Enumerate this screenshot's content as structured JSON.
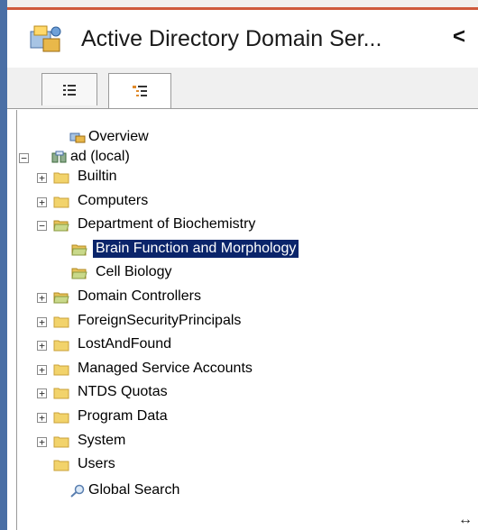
{
  "header": {
    "title": "Active Directory Domain Ser...",
    "collapse_symbol": "<",
    "icon": "ad-snapin-icon"
  },
  "tabs": [
    {
      "name": "list-view-tab",
      "icon": "list-icon",
      "active": false
    },
    {
      "name": "tree-view-tab",
      "icon": "tree-icon",
      "active": true
    }
  ],
  "tree": {
    "overview": "Overview",
    "root": "ad (local)",
    "items": [
      {
        "label": "Builtin",
        "expander": "+"
      },
      {
        "label": "Computers",
        "expander": "+"
      },
      {
        "label": "Department of Biochemistry",
        "expander": "−"
      },
      {
        "label": "Brain Function and Morphology",
        "selected": true
      },
      {
        "label": "Cell Biology"
      },
      {
        "label": "Domain Controllers",
        "expander": "+"
      },
      {
        "label": "ForeignSecurityPrincipals",
        "expander": "+"
      },
      {
        "label": "LostAndFound",
        "expander": "+"
      },
      {
        "label": "Managed Service Accounts",
        "expander": "+"
      },
      {
        "label": "NTDS Quotas",
        "expander": "+"
      },
      {
        "label": "Program Data",
        "expander": "+"
      },
      {
        "label": "System",
        "expander": "+"
      },
      {
        "label": "Users"
      }
    ],
    "global_search": "Global Search",
    "root_expander": "−"
  },
  "colors": {
    "selection": "#0a246a",
    "folder": "#f2d36b",
    "accent_bar": "#4a6fa5"
  },
  "resize_cursor": "↔"
}
